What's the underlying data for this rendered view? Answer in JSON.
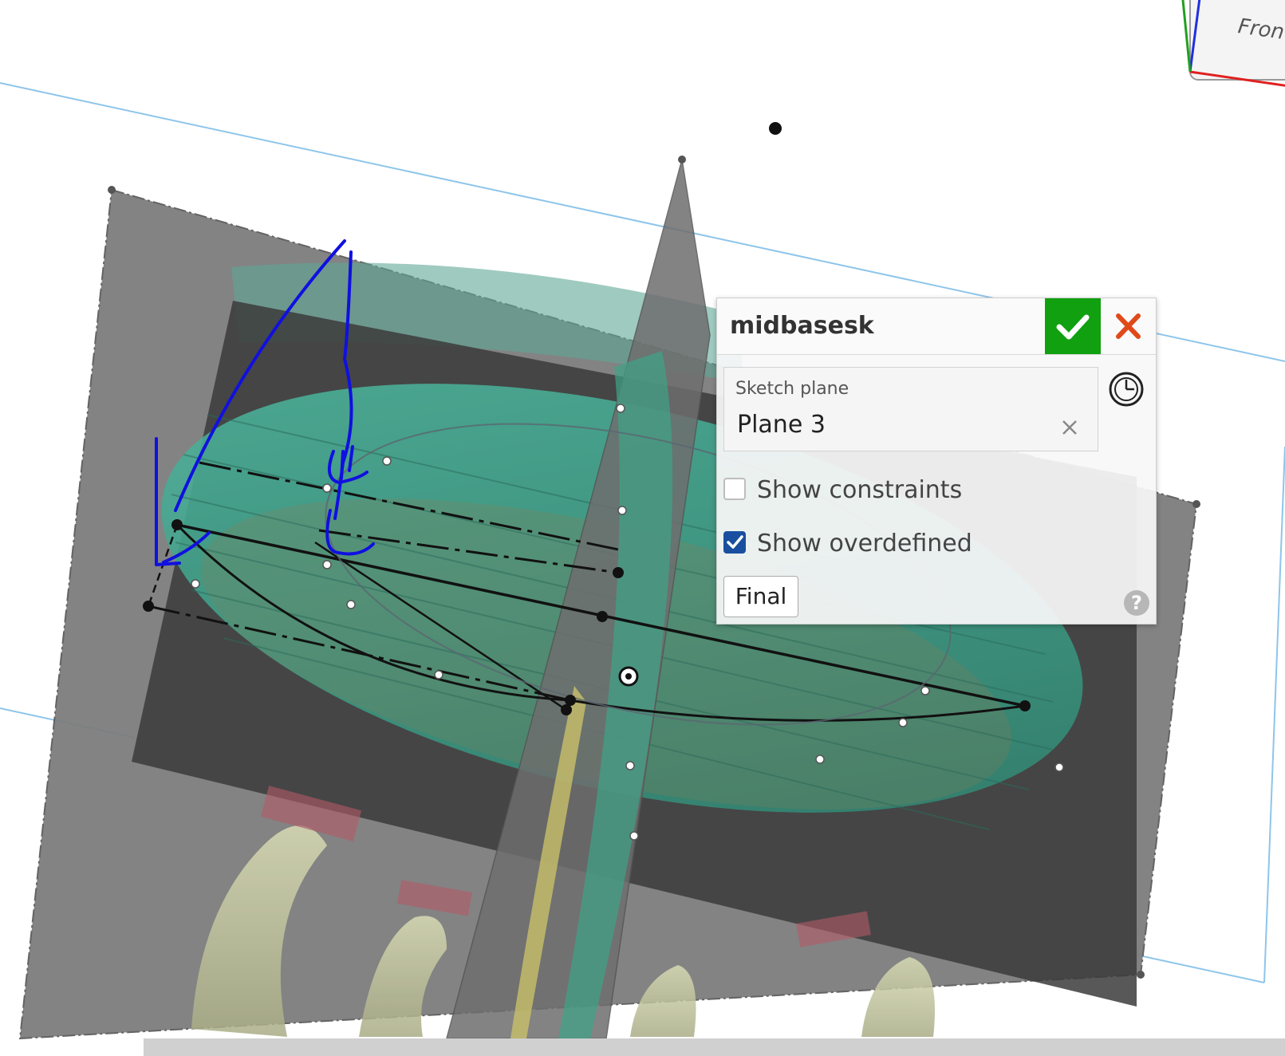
{
  "view_cube": {
    "face_label": "Fron"
  },
  "dialog": {
    "title": "midbasesk",
    "accept_icon": "checkmark-icon",
    "cancel_icon": "close-x-icon",
    "sketch_plane": {
      "label": "Sketch plane",
      "value": "Plane 3",
      "clear_icon": "clear-x-icon"
    },
    "history_icon": "clock-icon",
    "show_constraints": {
      "label": "Show constraints",
      "checked": false
    },
    "show_overdefined": {
      "label": "Show overdefined",
      "checked": true
    },
    "final_button": "Final",
    "help_icon": "?"
  },
  "colors": {
    "accept": "#10a010",
    "cancel": "#e04a1a",
    "checkbox_checked": "#1a4fa0",
    "annotation_ink": "#1010e0",
    "plane_line": "#8ec5ea"
  }
}
